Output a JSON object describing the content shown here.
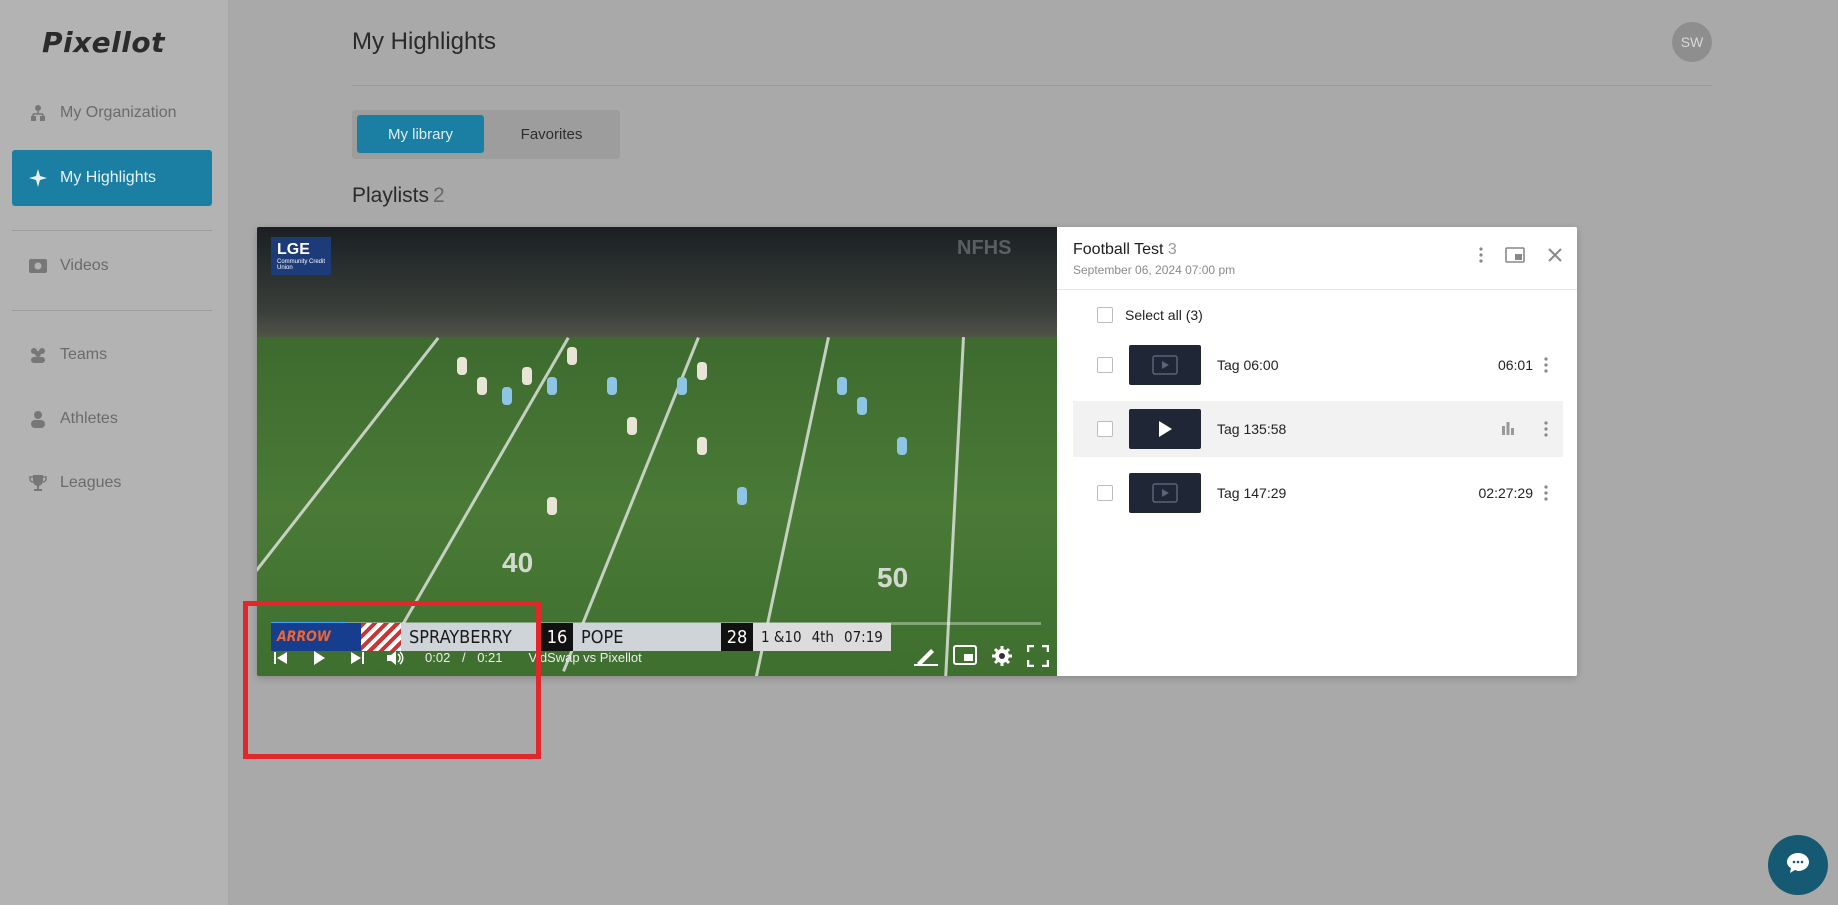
{
  "app": {
    "logo": "Pixellot"
  },
  "sidebar": {
    "items": [
      {
        "label": "My Organization",
        "icon": "org-icon"
      },
      {
        "label": "My Highlights",
        "icon": "sparkle-icon",
        "active": true
      },
      {
        "label": "Videos",
        "icon": "video-icon"
      },
      {
        "label": "Teams",
        "icon": "teams-icon"
      },
      {
        "label": "Athletes",
        "icon": "athlete-icon"
      },
      {
        "label": "Leagues",
        "icon": "trophy-icon"
      }
    ]
  },
  "header": {
    "title": "My Highlights",
    "avatar_initials": "SW"
  },
  "tabs": {
    "library": "My library",
    "favorites": "Favorites"
  },
  "playlists": {
    "label": "Playlists",
    "count": "2"
  },
  "player": {
    "overlay_logo": "LGE",
    "overlay_logo_sub": "Community Credit Union",
    "network": "NFHS",
    "yard_numbers": [
      "40",
      "50"
    ],
    "scorebug": {
      "sponsor": "ARROW",
      "home_team": "SPRAYBERRY",
      "home_score": "16",
      "away_team": "POPE",
      "away_score": "28",
      "down": "1 &10",
      "quarter": "4th",
      "clock": "07:19"
    },
    "current_time": "0:02",
    "separator": "/",
    "duration": "0:21",
    "title": "VidSwap vs Pixellot",
    "progress": 0.1
  },
  "playlist": {
    "title": "Football Test",
    "count": "3",
    "date": "September 06, 2024 07:00 pm",
    "select_all": "Select all (3)",
    "items": [
      {
        "label": "Tag 06:00",
        "duration": "06:01"
      },
      {
        "label": "Tag 135:58",
        "duration": "",
        "playing": true
      },
      {
        "label": "Tag 147:29",
        "duration": "02:27:29"
      }
    ]
  },
  "colors": {
    "accent": "#1a7fa3",
    "annotation": "#e3262a"
  }
}
